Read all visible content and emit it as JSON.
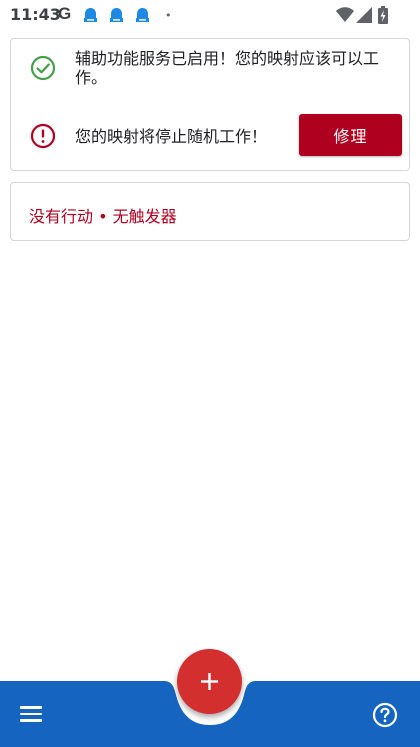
{
  "status_bar": {
    "time": "11:43",
    "google_icon": "G",
    "notification_icons": [
      "notification-icon",
      "notification-icon",
      "notification-icon"
    ],
    "more_indicator": "•",
    "wifi_icon": "wifi-icon",
    "signal_icon": "signal-icon",
    "battery_icon": "battery-charging-icon"
  },
  "status_card": {
    "enabled_icon": "check-circle-icon",
    "enabled_text": "辅助功能服务已启用！您的映射应该可以工作。",
    "warning_icon": "error-circle-icon",
    "warning_text": "您的映射将停止随机工作！",
    "fix_label": "修理"
  },
  "empty_card": {
    "text": "没有行动 • 无触发器"
  },
  "bottom_bar": {
    "menu_icon": "hamburger-menu-icon",
    "help_icon": "help-icon",
    "fab_icon": "add-icon",
    "fab_label": "+"
  },
  "colors": {
    "accent_red": "#b00020",
    "fab_red": "#d32f2f",
    "bar_blue": "#1565c0",
    "success_green": "#43a047"
  }
}
